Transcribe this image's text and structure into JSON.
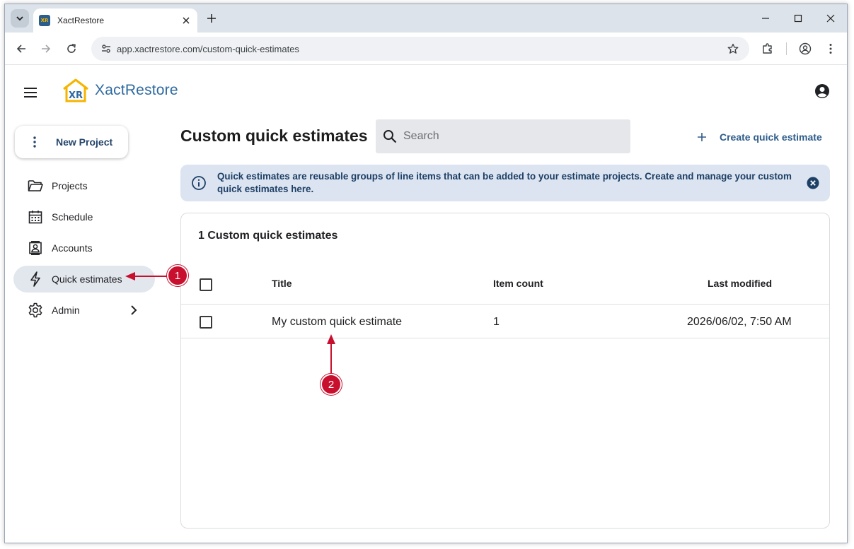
{
  "browser": {
    "tab_title": "XactRestore",
    "favicon_text": "XR",
    "url": "app.xactrestore.com/custom-quick-estimates"
  },
  "header": {
    "logo_mark_text": "XR",
    "app_name": "XactRestore"
  },
  "sidebar": {
    "new_project_label": "New Project",
    "items": [
      {
        "label": "Projects",
        "icon": "folder-open-icon"
      },
      {
        "label": "Schedule",
        "icon": "calendar-icon"
      },
      {
        "label": "Accounts",
        "icon": "contact-card-icon"
      },
      {
        "label": "Quick estimates",
        "icon": "lightning-bolt-icon",
        "active": true
      },
      {
        "label": "Admin",
        "icon": "gear-icon",
        "has_submenu": true
      }
    ]
  },
  "main": {
    "title": "Custom quick estimates",
    "search": {
      "placeholder": "Search"
    },
    "create_button_label": "Create quick estimate",
    "info_banner_text": "Quick estimates are reusable groups of line items that can be added to your estimate projects. Create and manage your custom quick estimates here.",
    "table": {
      "count_label": "1 Custom quick estimates",
      "columns": [
        "Title",
        "Item count",
        "Last modified"
      ],
      "rows": [
        {
          "title": "My custom quick estimate",
          "item_count": "1",
          "last_modified": "2026/06/02, 7:50 AM"
        }
      ]
    }
  },
  "annotations": {
    "callout_1": "1",
    "callout_2": "2"
  },
  "colors": {
    "brand_blue": "#2e6aa0",
    "banner_bg": "#dbe4f0",
    "annotation_red": "#c8102e",
    "active_nav_bg": "#e2e7ee"
  }
}
